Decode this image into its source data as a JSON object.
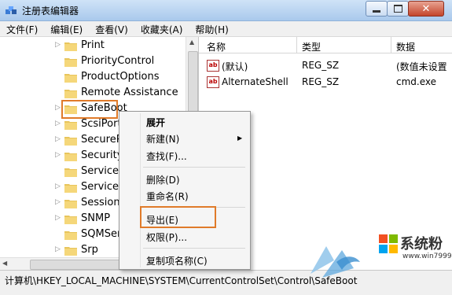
{
  "window": {
    "title": "注册表编辑器"
  },
  "menubar": [
    "文件(F)",
    "编辑(E)",
    "查看(V)",
    "收藏夹(A)",
    "帮助(H)"
  ],
  "tree": {
    "items": [
      "Print",
      "PriorityControl",
      "ProductOptions",
      "Remote Assistance",
      "SafeBoot",
      "ScsiPort",
      "SecureP",
      "SecurityP",
      "ServiceG",
      "ServiceP",
      "Session",
      "SNMP",
      "SQMSer",
      "Srp"
    ],
    "selected": "SafeBoot"
  },
  "list": {
    "headers": [
      "名称",
      "类型",
      "数据"
    ],
    "rows": [
      {
        "name": "(默认)",
        "type": "REG_SZ",
        "data": "(数值未设置"
      },
      {
        "name": "AlternateShell",
        "type": "REG_SZ",
        "data": "cmd.exe"
      }
    ]
  },
  "context_menu": {
    "items": [
      "展开",
      "新建(N)",
      "查找(F)...",
      "删除(D)",
      "重命名(R)",
      "导出(E)",
      "权限(P)...",
      "复制项名称(C)"
    ],
    "highlighted": "导出(E)"
  },
  "statusbar": {
    "path": "计算机\\HKEY_LOCAL_MACHINE\\SYSTEM\\CurrentControlSet\\Control\\SafeBoot"
  },
  "watermark": {
    "brand": "系统粉",
    "url": "www.win7999.com"
  },
  "colors": {
    "highlight_outline": "#e07b2a",
    "titlebar": "#bcd6f1"
  }
}
